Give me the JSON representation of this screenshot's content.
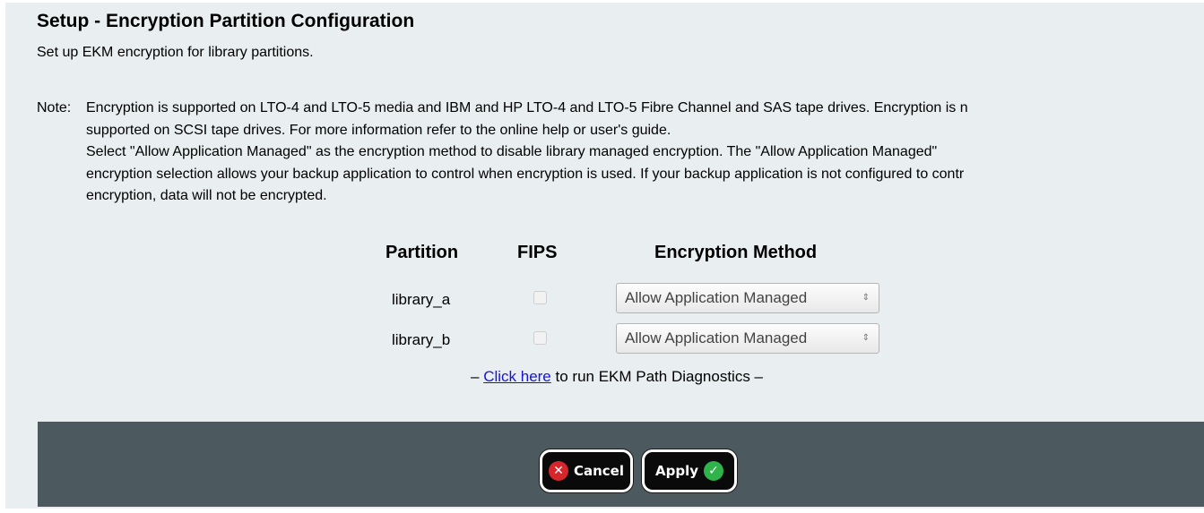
{
  "page": {
    "title": "Setup - Encryption Partition Configuration",
    "subtitle": "Set up EKM encryption for library partitions."
  },
  "note": {
    "label": "Note:",
    "lines": [
      "Encryption is supported on LTO-4 and LTO-5 media and IBM and HP LTO-4 and LTO-5 Fibre Channel and SAS tape drives. Encryption is n",
      "supported on SCSI tape drives. For more information refer to the online help or user's guide.",
      "Select \"Allow Application Managed\" as the encryption method to disable library managed encryption. The \"Allow Application Managed\"",
      "encryption selection allows your backup application to control when encryption is used. If your backup application is not configured to contr",
      "encryption, data will not be encrypted."
    ]
  },
  "table": {
    "headers": {
      "partition": "Partition",
      "fips": "FIPS",
      "method": "Encryption Method"
    },
    "rows": [
      {
        "partition": "library_a",
        "fips": false,
        "method": "Allow Application Managed"
      },
      {
        "partition": "library_b",
        "fips": false,
        "method": "Allow Application Managed"
      }
    ]
  },
  "diagnostics": {
    "prefix": "– ",
    "link": "Click here",
    "suffix": " to run EKM Path Diagnostics",
    "end": " –"
  },
  "footer": {
    "cancel_label": "Cancel",
    "apply_label": "Apply",
    "cancel_icon": "x-icon",
    "apply_icon": "checkmark-icon"
  },
  "colors": {
    "panel_bg": "#e9eef0",
    "footer_bg": "#4c5a60",
    "link": "#1515d6",
    "cancel_icon": "#d6262b",
    "apply_icon": "#2fb34a"
  }
}
